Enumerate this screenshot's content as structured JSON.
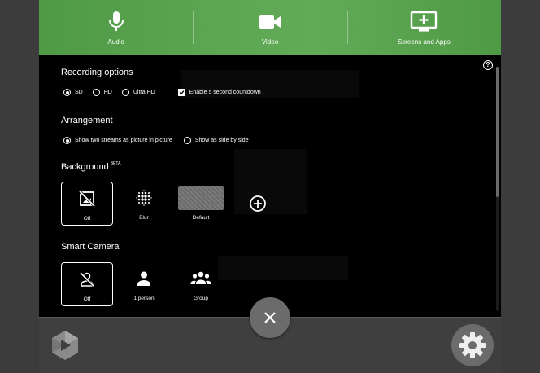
{
  "tabs": [
    {
      "label": "Audio",
      "icon": "microphone-icon"
    },
    {
      "label": "Video",
      "icon": "video-camera-icon"
    },
    {
      "label": "Screens and Apps",
      "icon": "monitor-add-icon"
    }
  ],
  "help_label": "?",
  "recording": {
    "title": "Recording options",
    "options": [
      {
        "label": "SD",
        "checked": true
      },
      {
        "label": "HD",
        "checked": false
      },
      {
        "label": "Ultra HD",
        "checked": false
      }
    ],
    "countdown_label": "Enable 5 second countdown",
    "countdown_checked": true
  },
  "arrangement": {
    "title": "Arrangement",
    "options": [
      {
        "label": "Show two streams as picture in picture",
        "checked": true
      },
      {
        "label": "Show as side by side",
        "checked": false
      }
    ]
  },
  "background": {
    "title": "Background",
    "badge": "BETA",
    "options": [
      {
        "label": "Off",
        "icon": "no-background-icon",
        "selected": true
      },
      {
        "label": "Blur",
        "icon": "blur-icon",
        "selected": false
      },
      {
        "label": "Default",
        "icon": "default-background-thumbnail",
        "selected": false
      }
    ],
    "add_icon": "add-circle-icon"
  },
  "smart_camera": {
    "title": "Smart Camera",
    "options": [
      {
        "label": "Off",
        "icon": "person-off-icon",
        "selected": true
      },
      {
        "label": "1 person",
        "icon": "person-icon",
        "selected": false
      },
      {
        "label": "Group",
        "icon": "group-icon",
        "selected": false
      }
    ]
  },
  "colors": {
    "accent_green": "#5da653",
    "panel_bg": "#000000",
    "bar_bg": "#3f3f3f"
  }
}
